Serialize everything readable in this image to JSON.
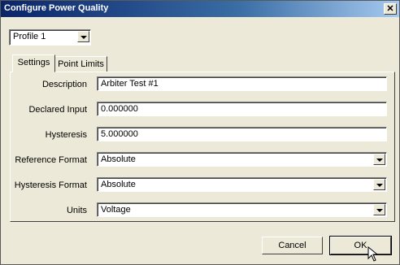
{
  "window": {
    "title": "Configure Power Quality",
    "close_glyph": "✕"
  },
  "profile": {
    "selected": "Profile 1"
  },
  "tabs": [
    {
      "label": "Settings",
      "active": true
    },
    {
      "label": "Point Limits",
      "active": false
    }
  ],
  "fields": {
    "description": {
      "label": "Description",
      "value": "Arbiter Test #1"
    },
    "declared_input": {
      "label": "Declared Input",
      "value": "0.000000"
    },
    "hysteresis": {
      "label": "Hysteresis",
      "value": "5.000000"
    },
    "reference_format": {
      "label": "Reference Format",
      "value": "Absolute"
    },
    "hysteresis_format": {
      "label": "Hysteresis Format",
      "value": "Absolute"
    },
    "units": {
      "label": "Units",
      "value": "Voltage"
    }
  },
  "buttons": {
    "cancel": "Cancel",
    "ok": "OK"
  },
  "colors": {
    "titlebar_start": "#0a246a",
    "titlebar_end": "#a6caf0",
    "dialog_bg": "#ece9d8"
  }
}
